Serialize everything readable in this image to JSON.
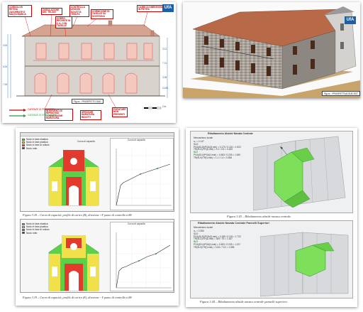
{
  "colors": {
    "red": "#cc0000",
    "green": "#2a9a3a",
    "wall": "#b9b0a6",
    "pushover_green": "#5dd04a",
    "pushover_red": "#e23b2e",
    "pushover_yellow": "#f0e04a"
  },
  "elevation": {
    "logo": "UfA",
    "labels": [
      "CORDOLI IN RETINA ZAVORRATE E MALTA BIANCA",
      "ONDULAZIONE DEL TELAIO",
      "CONTROLLA LESIONI SOLETTA TENUTA",
      "CORNICIONE IN TAVELLE SU SOSTEGNO",
      "CORPO RECENTE IN C.A. CON TAVELLE",
      "CAMBI DI DIMENSIONI IN PIETRA",
      "FORATURE NON PRESENTI"
    ],
    "legend": [
      "CARENZE DI PROGETTO",
      "CARENZE DI ESECUZIONE"
    ],
    "note_box_1": "INTERVENTI DI RIPRISTINO CONNESSIONE MURATURA",
    "note_box_2": "SPESSORI MURATURA RIDOTTI",
    "dimensions": [
      "3.00",
      "5.00",
      "7.00",
      "3.21",
      "7.21",
      "3.28",
      "10.85"
    ],
    "figure_tag": "Fig.xx - PROSPETTO SUD",
    "scale_label": "2 m"
  },
  "render3d": {
    "logo": "UfA",
    "figure_tag": "Fig.xx - PROSPETTIVA SUD EST"
  },
  "pushover_top": {
    "header": "Curva di capacità",
    "legend": [
      {
        "label": "Nodo in fase elastica",
        "color": "#5dd04a"
      },
      {
        "label": "Nodo in fase plastica",
        "color": "#f0e04a"
      },
      {
        "label": "Nodo in fase di rottura",
        "color": "#e23b2e"
      },
      {
        "label": "Nodo rotto",
        "color": "#333333"
      }
    ],
    "chart_title": "Curva di capacità",
    "caption": "Figura 3.18 – Curva di capacità, profilo di carico (B), direzione +Y punto di controllo n.88."
  },
  "pushover_bottom": {
    "legend": [
      {
        "label": "Nodo in fase elastica",
        "color": "#5dd04a"
      },
      {
        "label": "Nodo in fase plastica",
        "color": "#f0e04a"
      },
      {
        "label": "Nodo in fase di rottura",
        "color": "#e23b2e"
      },
      {
        "label": "Nodo rotto",
        "color": "#333333"
      }
    ],
    "chart_title": "Curva di capacità",
    "caption": "Figura 3.19 – Curva di capacità, profilo di carico (E), direzione −Y punto di controllo n.88."
  },
  "mech_top": {
    "title": "Ribaltamento Abside Navata Centrale",
    "subtitle": "Meccanismo locale",
    "lines": [
      "α₀ = 0.147",
      "SLD",
      "PGA(SLD)/PGA(D,min) = 0.170 / 0.115 = 1.522",
      "TR(SLD)/TR(D,min) = 0.1 / 0.5 = 0.183",
      "SLV",
      "PGA(SLV)/PGA(V,min) = 0.383 / 0.235 = 1.630",
      "TR(SLV)/TR(V,min) = 1.1 / 1.4 = 0.836"
    ],
    "caption": "Figura 3.43 – Ribaltamento abside navata centrale."
  },
  "mech_bottom": {
    "title": "Ribaltamento Abside Navata Centrale Pannelli Superiori",
    "subtitle": "Meccanismo locale",
    "lines": [
      "α₀ = 0.350",
      "SLD",
      "PGA(SLD)/PGA(D,min) = 0.185 / 0.115 = 1.722",
      "TR(SLD)/TR(D,min) = 309 / 75 = 1.167",
      "SLV",
      "PGA(SLV)/PGA(V,min) = 0.383 / 0.235 = 1.197",
      "TR(SLV)/TR(V,min) = 1131 / 712 = 1.558"
    ],
    "caption": "Figura 3.44 – Ribaltamento abside navata centrale pannelli superiori."
  }
}
